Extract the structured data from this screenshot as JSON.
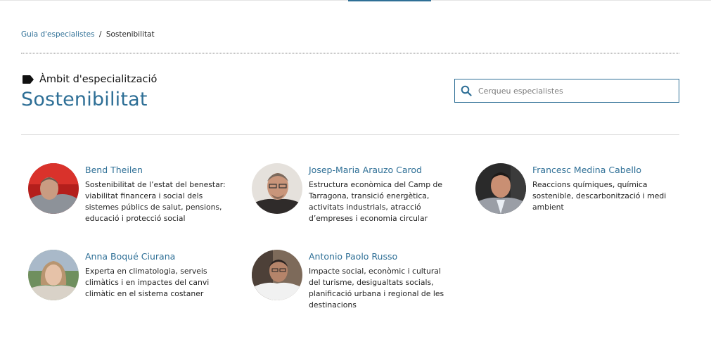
{
  "breadcrumb": {
    "parent": "Guia d'especialistes",
    "separator": "/",
    "current": "Sostenibilitat"
  },
  "header": {
    "section_label": "Àmbit d'especialització",
    "title": "Sostenibilitat"
  },
  "search": {
    "placeholder": "Cerqueu especialistes",
    "value": ""
  },
  "colors": {
    "accent": "#2e6f96",
    "text": "#222222",
    "divider": "#dcdcdc"
  },
  "specialists": [
    {
      "name": "Bend Theilen",
      "description": "Sostenibilitat de l’estat del benestar: viabilitat financera i social dels sistemes públics de salut, pensions, educació i protecció social"
    },
    {
      "name": "Josep-Maria Arauzo Carod",
      "description": "Estructura econòmica del Camp de Tarragona, transició energètica, activitats industrials, atracció d’empreses i economia circular"
    },
    {
      "name": "Francesc Medina Cabello",
      "description": "Reaccions químiques, química sostenible, descarbonització i medi ambient"
    },
    {
      "name": "Anna Boqué Ciurana",
      "description": "Experta en climatologia, serveis climàtics i en impactes del canvi climàtic en el sistema costaner"
    },
    {
      "name": "Antonio Paolo Russo",
      "description": "Impacte social, econòmic i cultural del turisme, desigualtats socials, planificació urbana i regional de les destinacions"
    }
  ]
}
